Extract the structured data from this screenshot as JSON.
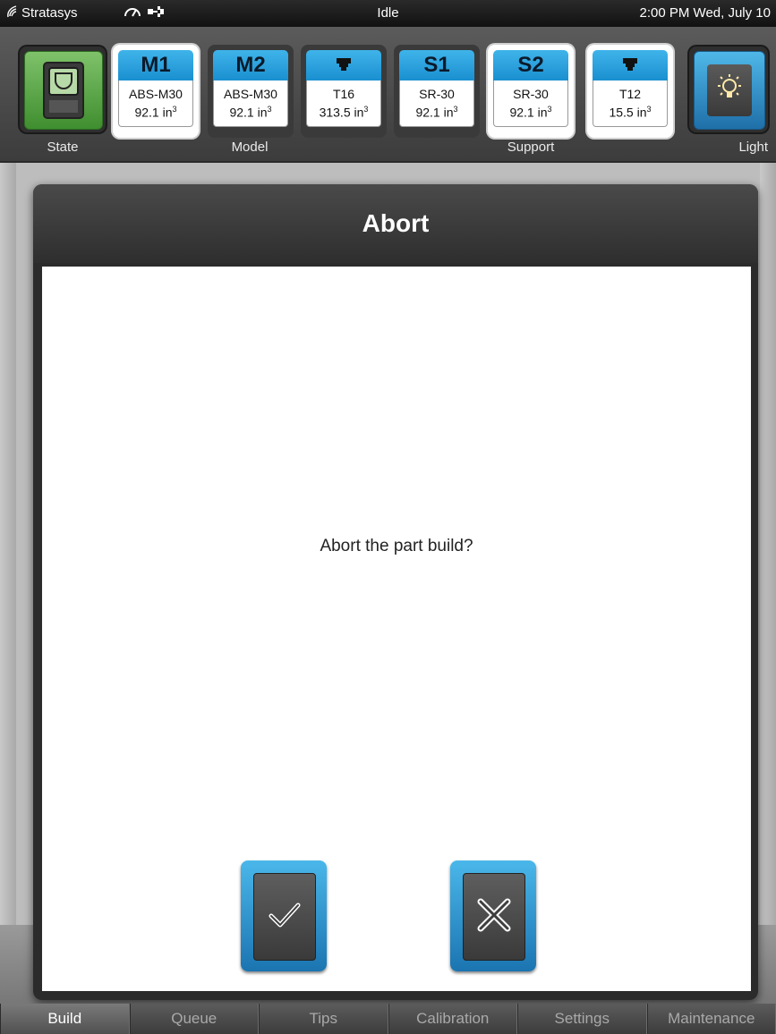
{
  "status_bar": {
    "brand": "Stratasys",
    "state": "Idle",
    "clock": "2:00 PM Wed, July 10"
  },
  "header": {
    "state_label": "State",
    "model_label": "Model",
    "support_label": "Support",
    "light_label": "Light",
    "bays": [
      {
        "tab": "M1",
        "material": "ABS-M30",
        "volume": "92.1 in",
        "unit_exp": "3",
        "selected": true
      },
      {
        "tab": "M2",
        "material": "ABS-M30",
        "volume": "92.1 in",
        "unit_exp": "3",
        "selected": false
      },
      {
        "tab": "",
        "icon": "tip-icon",
        "material": "T16",
        "volume": "313.5 in",
        "unit_exp": "3",
        "selected": false
      },
      {
        "tab": "S1",
        "material": "SR-30",
        "volume": "92.1 in",
        "unit_exp": "3",
        "selected": false
      },
      {
        "tab": "S2",
        "material": "SR-30",
        "volume": "92.1 in",
        "unit_exp": "3",
        "selected": true
      },
      {
        "tab": "",
        "icon": "tip-icon",
        "material": "T12",
        "volume": "15.5 in",
        "unit_exp": "3",
        "selected": true
      }
    ]
  },
  "dialog": {
    "title": "Abort",
    "message": "Abort the part build?"
  },
  "tabs": [
    {
      "label": "Build",
      "active": true
    },
    {
      "label": "Queue",
      "active": false
    },
    {
      "label": "Tips",
      "active": false
    },
    {
      "label": "Calibration",
      "active": false
    },
    {
      "label": "Settings",
      "active": false
    },
    {
      "label": "Maintenance",
      "active": false
    }
  ],
  "colors": {
    "accent_blue": "#2a9ddb",
    "state_green": "#5aa845",
    "dialog_dark": "#2b2b2b"
  }
}
